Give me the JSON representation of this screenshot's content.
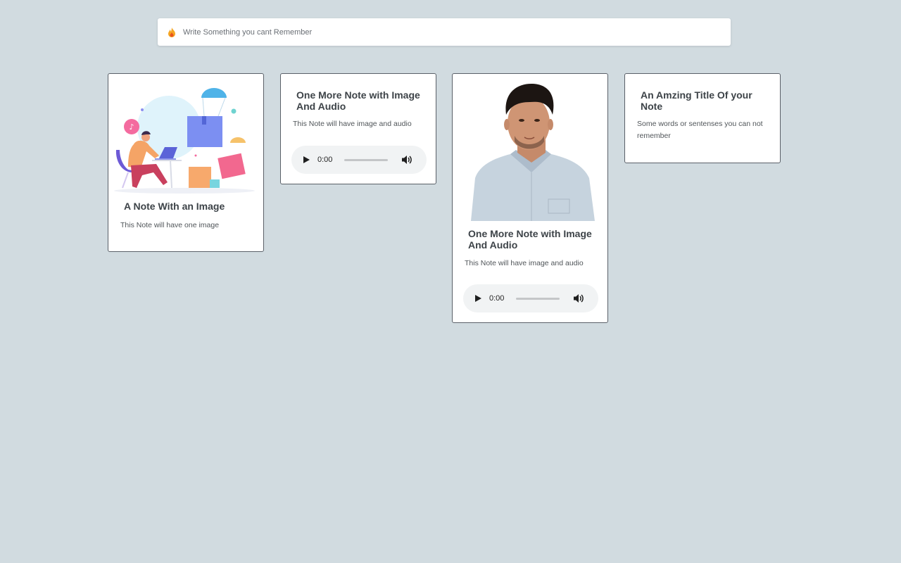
{
  "search": {
    "placeholder": "Write Something you cant Remember",
    "icon": "flame-icon"
  },
  "notes": [
    {
      "title": "A Note With an Image",
      "description": "This Note will have one image",
      "image": "illustration-person-laptop"
    },
    {
      "title": "One More Note with Image And Audio",
      "description": "This Note will have image and audio",
      "audio": {
        "time": "0:00"
      }
    },
    {
      "title": "One More Note with Image And Audio",
      "description": "This Note will have image and audio",
      "image": "photo-man-portrait",
      "audio": {
        "time": "0:00"
      }
    },
    {
      "title": "An Amzing Title Of your Note",
      "description": "Some words or sentenses you can not remember"
    }
  ],
  "colors": {
    "background": "#d1dbe0",
    "card": "#ffffff",
    "card_border": "#5a6068",
    "audio_bg": "#f1f3f4"
  }
}
